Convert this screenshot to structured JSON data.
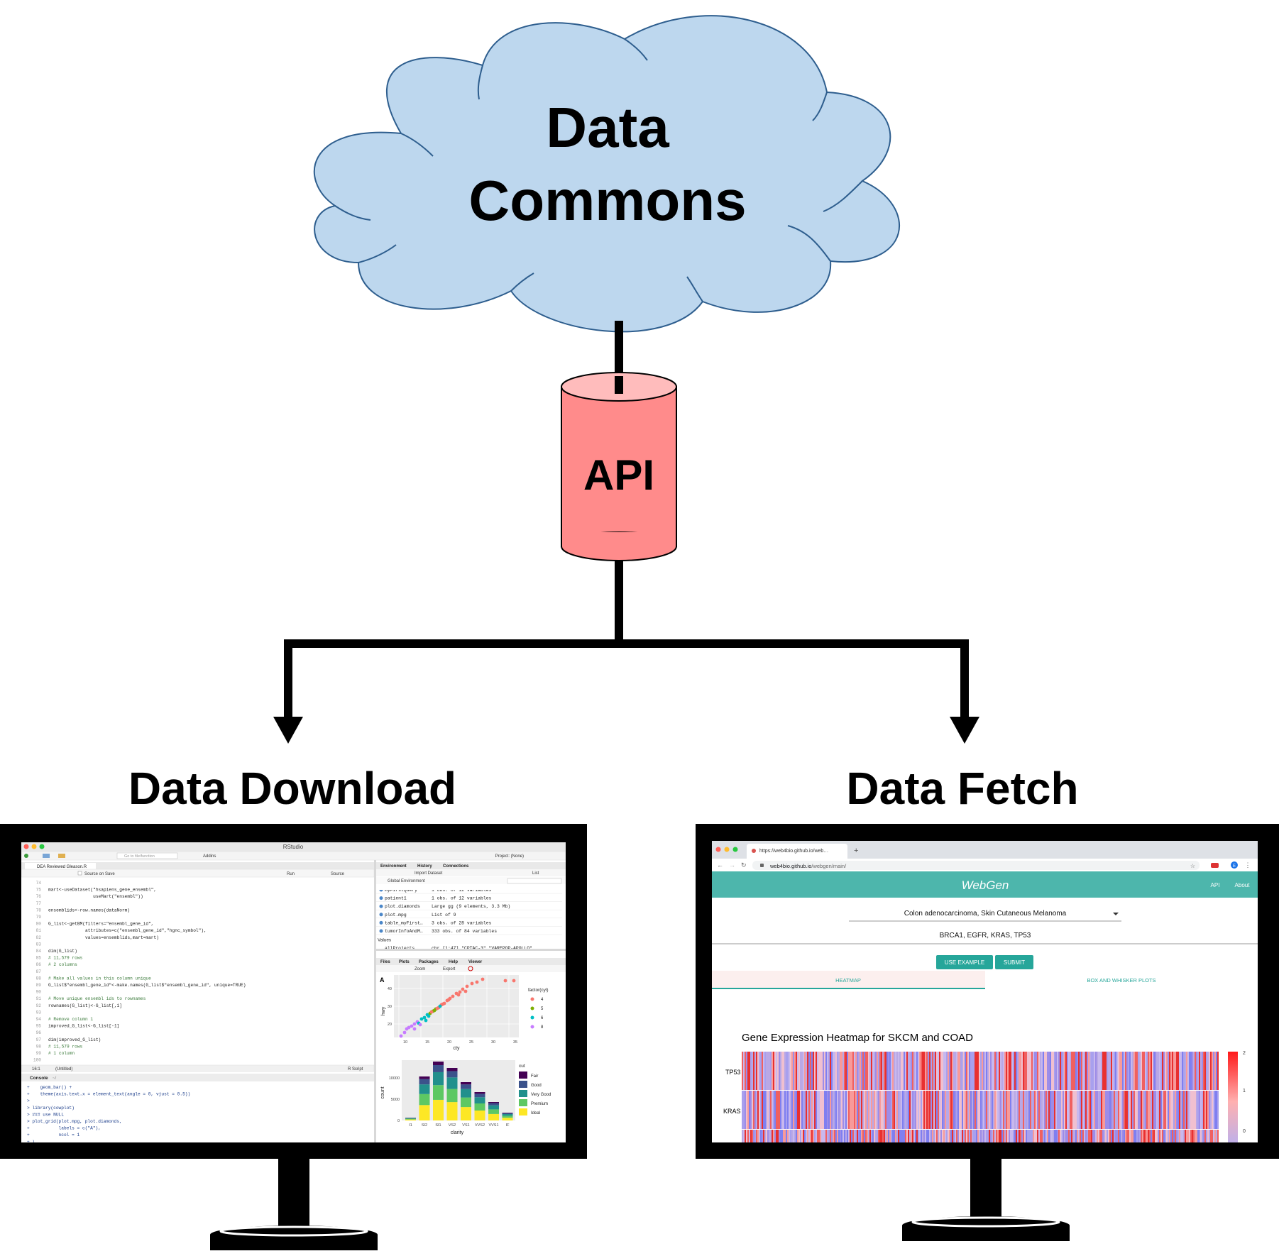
{
  "cloud": {
    "line1": "Data",
    "line2": "Commons"
  },
  "api": {
    "label": "API"
  },
  "left_branch": {
    "title": "Data Download"
  },
  "right_branch": {
    "title": "Data Fetch"
  },
  "rstudio": {
    "window_title": "RStudio",
    "goto_placeholder": "Go to file/function",
    "addins": "Addins",
    "project": "Project: (None)",
    "editor_tab": "DEA Reviewed Gleason.R",
    "source_on_save": "Source on Save",
    "run": "Run",
    "source": "Source",
    "code_lines": [
      {
        "n": "74",
        "t": ""
      },
      {
        "n": "75",
        "t": "mart<-useDataset(\"hsapiens_gene_ensembl\","
      },
      {
        "n": "76",
        "t": "                 useMart(\"ensembl\"))"
      },
      {
        "n": "77",
        "t": ""
      },
      {
        "n": "78",
        "t": "ensemblids<-row.names(dataNorm)"
      },
      {
        "n": "79",
        "t": ""
      },
      {
        "n": "80",
        "t": "G_list<-getBM(filters=\"ensembl_gene_id\","
      },
      {
        "n": "81",
        "t": "              attributes=c(\"ensembl_gene_id\",\"hgnc_symbol\"),"
      },
      {
        "n": "82",
        "t": "              values=ensemblids,mart=mart)"
      },
      {
        "n": "83",
        "t": ""
      },
      {
        "n": "84",
        "t": "dim(G_list)"
      },
      {
        "n": "85",
        "t": "# 11,579 rows"
      },
      {
        "n": "86",
        "t": "# 2 columns"
      },
      {
        "n": "87",
        "t": ""
      },
      {
        "n": "88",
        "t": "# Make all values in this column unique"
      },
      {
        "n": "89",
        "t": "G_list$\"ensembl_gene_id\"<-make.names(G_list$\"ensembl_gene_id\", unique=TRUE)"
      },
      {
        "n": "90",
        "t": ""
      },
      {
        "n": "91",
        "t": "# Move unique ensembl ids to rownames"
      },
      {
        "n": "92",
        "t": "rownames(G_list)<-G_list[,1]"
      },
      {
        "n": "93",
        "t": ""
      },
      {
        "n": "94",
        "t": "# Remove column 1"
      },
      {
        "n": "95",
        "t": "improved_G_list<-G_list[-1]"
      },
      {
        "n": "96",
        "t": ""
      },
      {
        "n": "97",
        "t": "dim(improved_G_list)"
      },
      {
        "n": "98",
        "t": "# 11,579 rows"
      },
      {
        "n": "99",
        "t": "# 1 column"
      },
      {
        "n": "100",
        "t": ""
      }
    ],
    "status_pos": "16:1",
    "status_scope": "(Untitled)",
    "status_type": "R Script",
    "console_tab": "Console",
    "console_path": "~/",
    "console_lines": [
      "+    geom_bar() +",
      "+    theme(axis.text.x = element_text(angle = 0, vjust = 0.5))",
      ">",
      "> library(cowplot)",
      "> ### use NULL",
      "> plot_grid(plot.mpg, plot.diamonds,",
      "+           labels = c(\"A\"),",
      "+           ncol = 1",
      "+ )"
    ],
    "env_tabs": [
      "Environment",
      "History",
      "Connections"
    ],
    "import_dataset": "Import Dataset",
    "list_view": "List",
    "global_env": "Global Environment",
    "env_rows": [
      {
        "name": "myFirstQuery",
        "value": "1 obs. of 12 variables"
      },
      {
        "name": "patient1",
        "value": "1 obs. of 12 variables"
      },
      {
        "name": "plot.diamonds",
        "value": "Large gg (9 elements, 3.3 Mb)"
      },
      {
        "name": "plot.mpg",
        "value": "List of 9"
      },
      {
        "name": "table_myFirst…",
        "value": "3 obs. of 28 variables"
      },
      {
        "name": "tumorInfoAndM…",
        "value": "333 obs. of 84 variables"
      }
    ],
    "values_header": "Values",
    "values_row": {
      "name": "allProjects",
      "value": "chr [1:47] \"CPTAC-3\" \"VAREPOP-APOLLO\" …"
    },
    "files_tabs": [
      "Files",
      "Plots",
      "Packages",
      "Help",
      "Viewer"
    ],
    "zoom": "Zoom",
    "export": "Export",
    "plot_a_label": "A",
    "scatter": {
      "x_label": "cty",
      "y_label": "hwy",
      "x_ticks": [
        "10",
        "15",
        "20",
        "25",
        "30",
        "35"
      ],
      "y_ticks": [
        "20",
        "30",
        "40"
      ],
      "legend_title": "factor(cyl)",
      "legend": [
        {
          "label": "4",
          "color": "#f8766d"
        },
        {
          "label": "5",
          "color": "#7cae00"
        },
        {
          "label": "6",
          "color": "#00bfc4"
        },
        {
          "label": "8",
          "color": "#c77cff"
        }
      ]
    },
    "bars": {
      "x_label": "clarity",
      "y_label": "count",
      "y_ticks": [
        "0",
        "5000",
        "10000"
      ],
      "categories": [
        "I1",
        "SI2",
        "SI1",
        "VS2",
        "VS1",
        "VVS2",
        "VVS1",
        "IF"
      ],
      "legend_title": "cut",
      "legend": [
        {
          "label": "Fair",
          "color": "#440154"
        },
        {
          "label": "Good",
          "color": "#3b528b"
        },
        {
          "label": "Very Good",
          "color": "#21908c"
        },
        {
          "label": "Premium",
          "color": "#5dc863"
        },
        {
          "label": "Ideal",
          "color": "#fde725"
        }
      ]
    }
  },
  "browser": {
    "tab_title": "https://web4bio.github.io/web…",
    "url_prefix": "web4bio.github.io",
    "url_path": "/webgen/main/",
    "avatar": "E",
    "app_title": "WebGen",
    "nav_api": "API",
    "nav_about": "About",
    "select_value": "Colon adenocarcinoma, Skin Cutaneous Melanoma",
    "genes_value": "BRCA1, EGFR, KRAS, TP53",
    "btn_example": "USE EXAMPLE",
    "btn_submit": "SUBMIT",
    "tab_heatmap": "HEATMAP",
    "tab_boxplot": "BOX AND WHISKER PLOTS",
    "heatmap_title": "Gene Expression Heatmap for SKCM and COAD",
    "heatmap_rows": [
      "TP53",
      "KRAS"
    ],
    "colorbar_ticks": [
      "2",
      "1",
      "0"
    ]
  },
  "colors": {
    "cloud_fill": "#bdd7ee",
    "cloud_stroke": "#2e5e8e",
    "api_fill": "#ff8b8b",
    "api_top": "#ffbcbc",
    "webgen_teal": "#4db6ac"
  }
}
